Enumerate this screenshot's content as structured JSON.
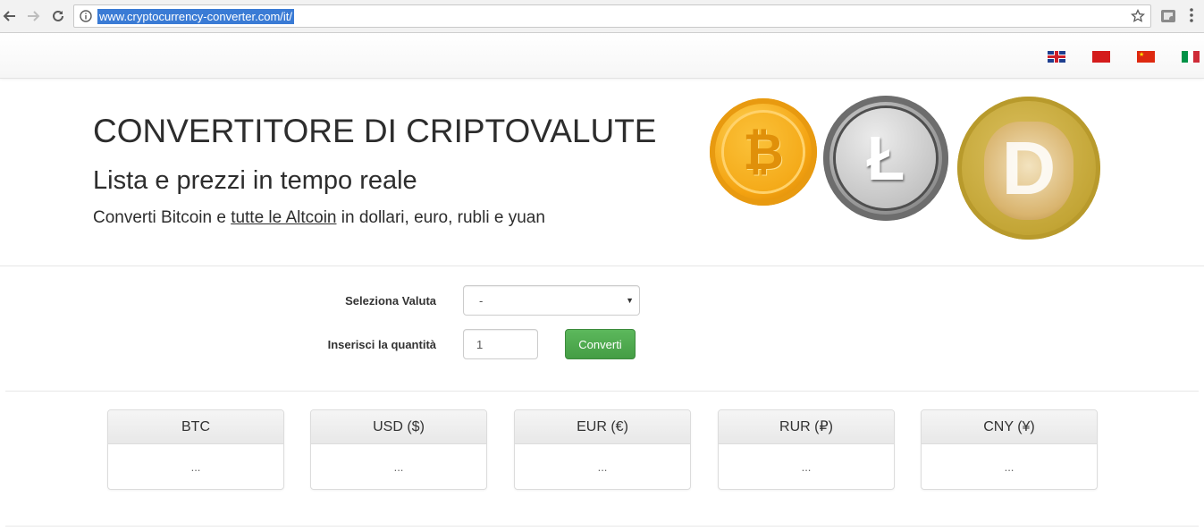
{
  "browser": {
    "url": "www.cryptocurrency-converter.com/it/",
    "back_icon": "arrow-left-icon",
    "forward_icon": "arrow-right-icon",
    "reload_icon": "reload-icon",
    "info_icon": "info-icon",
    "star_icon": "star-icon",
    "extension_icon": "extension-icon",
    "menu_icon": "kebab-menu-icon",
    "highlight_color": "#3a7bd5"
  },
  "navbar": {
    "languages": [
      "english",
      "russian",
      "chinese",
      "italian"
    ]
  },
  "hero": {
    "title": "CONVERTITORE DI CRIPTOVALUTE",
    "subtitle": "Lista e prezzi in tempo reale",
    "description_before": "Converti Bitcoin e ",
    "description_link": "tutte le Altcoin",
    "description_after": " in dollari, euro, rubli e yuan",
    "coins": [
      "bitcoin",
      "litecoin",
      "dogecoin"
    ],
    "bitcoin_glyph": "₿",
    "litecoin_glyph": "Ł",
    "dogecoin_glyph": "D"
  },
  "form": {
    "currency_label": "Seleziona Valuta",
    "currency_selected": "-",
    "quantity_label": "Inserisci la quantità",
    "quantity_value": "1",
    "convert_label": "Converti",
    "button_color": "#5cb85c"
  },
  "results": [
    {
      "header": "BTC",
      "value": "..."
    },
    {
      "header": "USD ($)",
      "value": "..."
    },
    {
      "header": "EUR (€)",
      "value": "..."
    },
    {
      "header": "RUR (₽)",
      "value": "..."
    },
    {
      "header": "CNY (¥)",
      "value": "..."
    }
  ]
}
